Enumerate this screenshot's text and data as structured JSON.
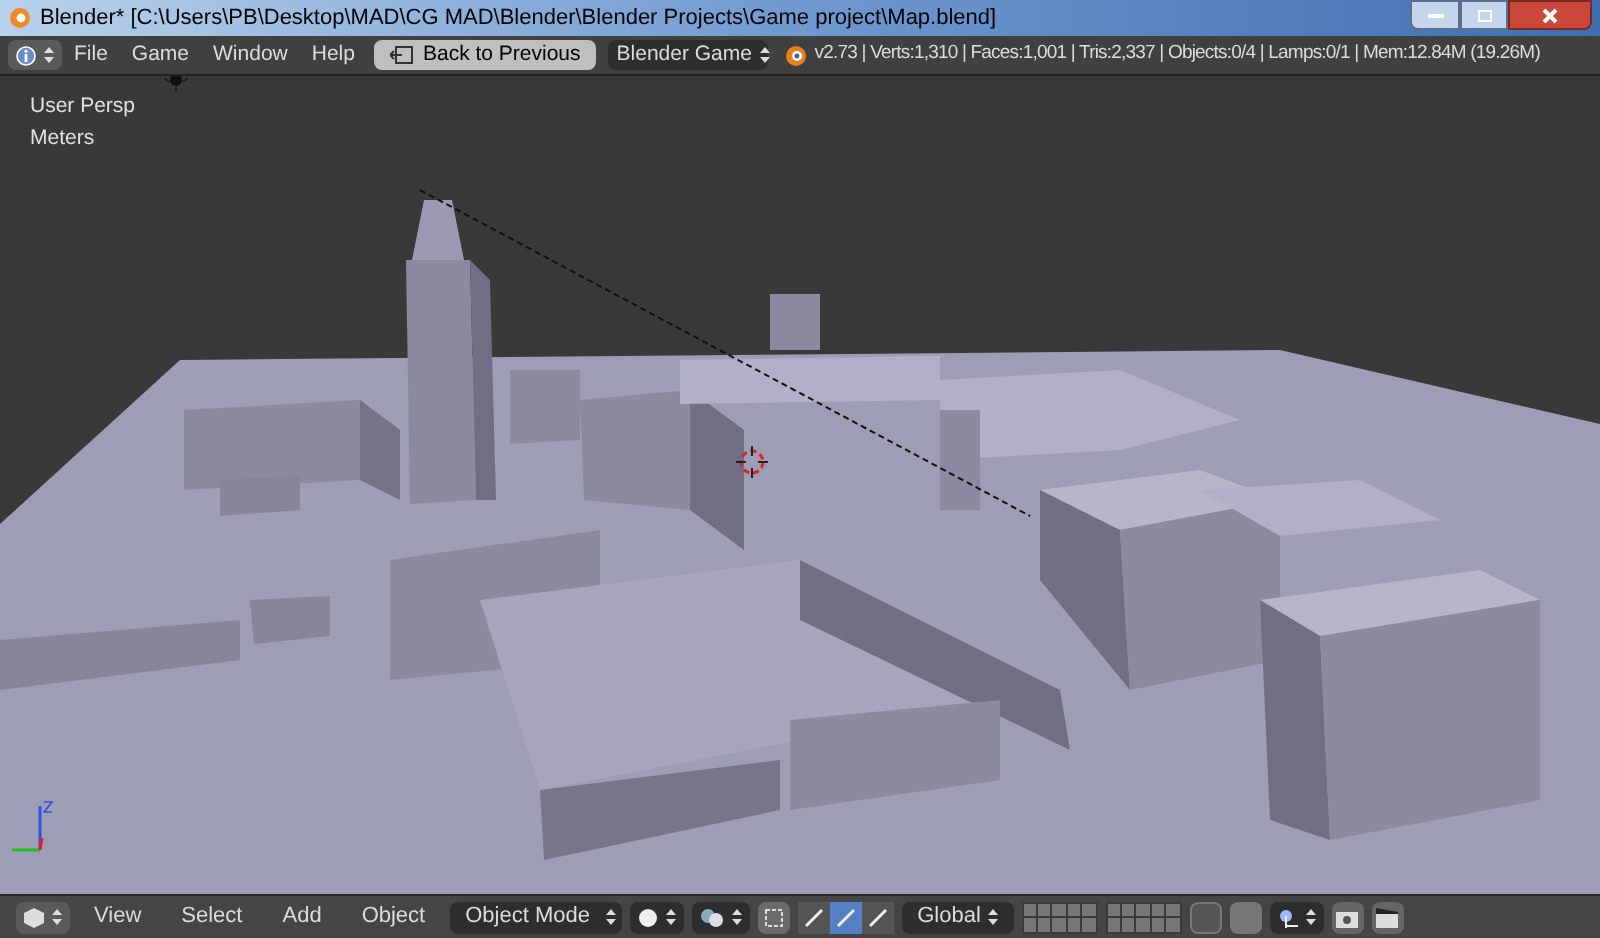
{
  "window": {
    "title": "Blender* [C:\\Users\\PB\\Desktop\\MAD\\CG MAD\\Blender\\Blender Projects\\Game project\\Map.blend]"
  },
  "info_header": {
    "menus": [
      "File",
      "Game",
      "Window",
      "Help"
    ],
    "back_button": "Back to Previous",
    "engine": "Blender Game",
    "stats": "v2.73 | Verts:1,310 | Faces:1,001 | Tris:2,337 | Objects:0/4 | Lamps:0/1 | Mem:12.84M (19.26M)"
  },
  "viewport": {
    "view_name": "User Persp",
    "units": "Meters"
  },
  "view_header": {
    "menus": [
      "View",
      "Select",
      "Add",
      "Object"
    ],
    "mode": "Object Mode",
    "manipulators": [
      {
        "selected": false
      },
      {
        "selected": true
      },
      {
        "selected": false
      }
    ],
    "orientation": "Global"
  }
}
